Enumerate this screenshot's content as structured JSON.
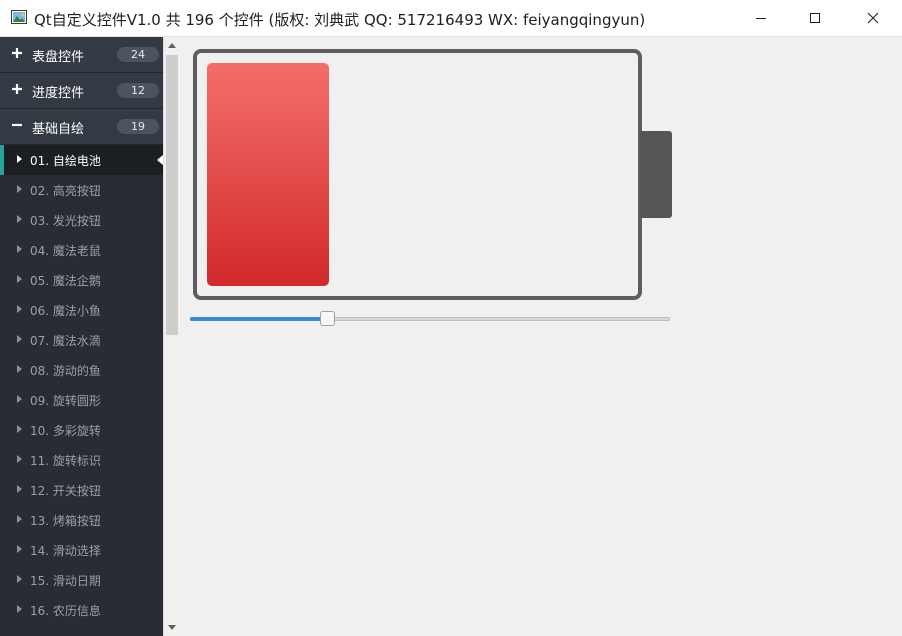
{
  "window": {
    "title": "Qt自定义控件V1.0 共 196 个控件 (版权: 刘典武 QQ: 517216493 WX: feiyangqingyun)",
    "icons": {
      "app": "app-image-icon",
      "minimize": "minimize-icon",
      "maximize": "maximize-icon",
      "close": "close-icon"
    }
  },
  "sidebar": {
    "groups": [
      {
        "label": "表盘控件",
        "count": "24",
        "sign": "plus-icon"
      },
      {
        "label": "进度控件",
        "count": "12",
        "sign": "plus-icon"
      },
      {
        "label": "基础自绘",
        "count": "19",
        "sign": "minus-icon"
      }
    ],
    "items": [
      {
        "label": "01. 自绘电池",
        "active": true
      },
      {
        "label": "02. 高亮按钮"
      },
      {
        "label": "03. 发光按钮"
      },
      {
        "label": "04. 魔法老鼠"
      },
      {
        "label": "05. 魔法企鹅"
      },
      {
        "label": "06. 魔法小鱼"
      },
      {
        "label": "07. 魔法水滴"
      },
      {
        "label": "08. 游动的鱼"
      },
      {
        "label": "09. 旋转圆形"
      },
      {
        "label": "10. 多彩旋转"
      },
      {
        "label": "11. 旋转标识"
      },
      {
        "label": "12. 开关按钮"
      },
      {
        "label": "13. 烤箱按钮"
      },
      {
        "label": "14. 滑动选择"
      },
      {
        "label": "15. 滑动日期"
      },
      {
        "label": "16. 农历信息"
      }
    ]
  },
  "battery": {
    "level_percent": 28,
    "colors": {
      "fill_top": "#f36e6a",
      "fill_bottom": "#d2292c",
      "border": "#5e5e5e",
      "head": "#555555"
    }
  },
  "slider": {
    "value_percent": 28,
    "colors": {
      "filled": "#2f8ccf",
      "track": "#d8d8d8"
    }
  },
  "colors": {
    "sidebar_bg": "#282c34",
    "accent": "#26a69a"
  }
}
